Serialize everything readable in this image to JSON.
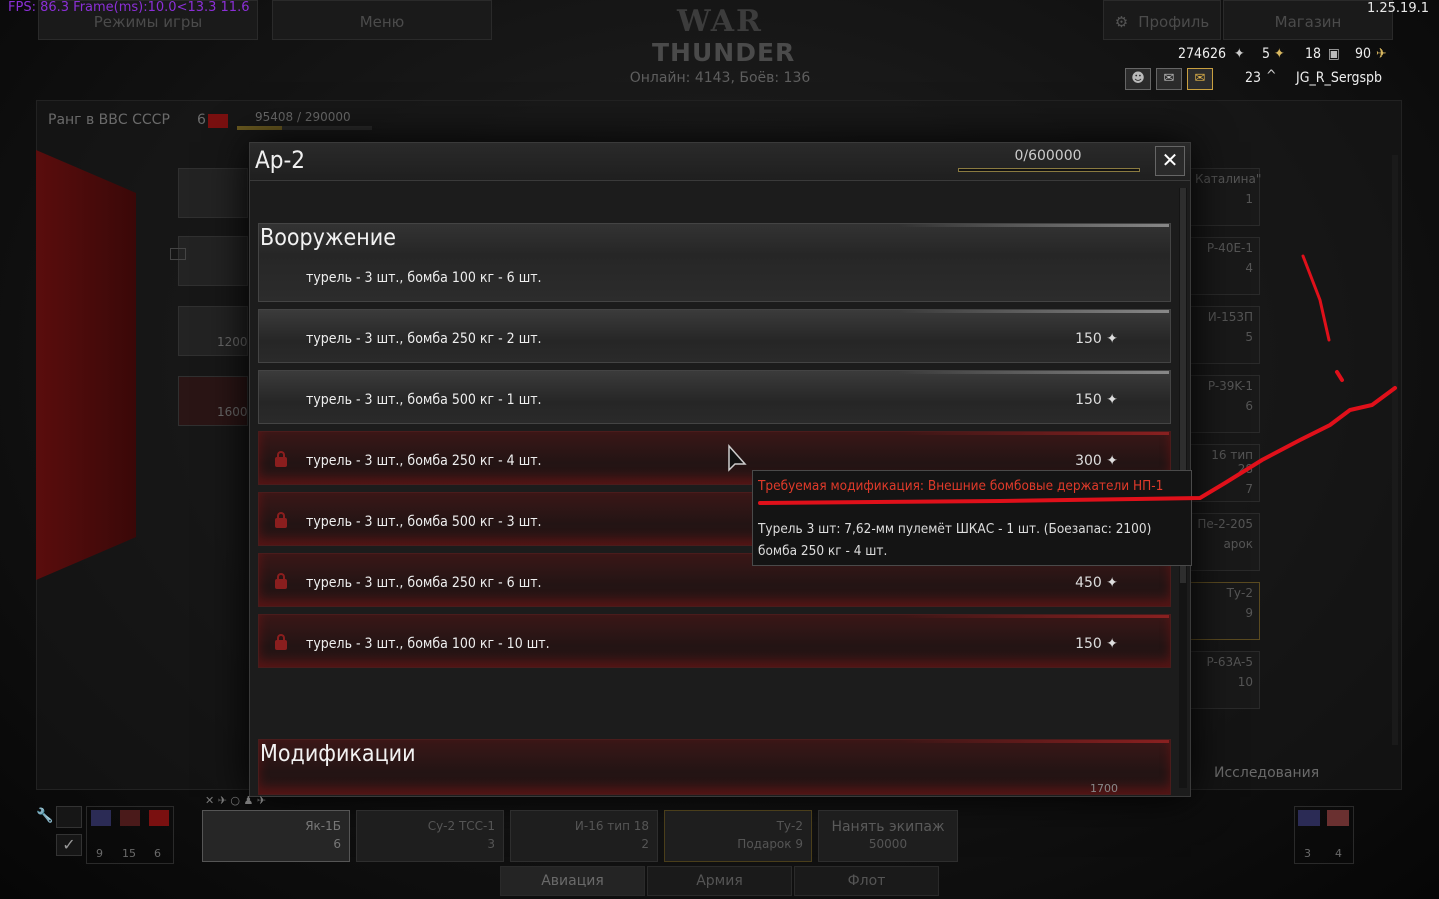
{
  "hud": {
    "fps": "FPS: 86.3 Frame(ms):10.0<13.3 11.6",
    "version": "1.25.19.1"
  },
  "topbar": {
    "game_modes": "Режимы игры",
    "menu": "Меню",
    "profile": "Профиль",
    "shop": "Магазин"
  },
  "logo": {
    "line1": "WAR",
    "line2": "THUNDER"
  },
  "online": "Онлайн: 4143, Боёв: 136",
  "player": {
    "silver_lions": "274626",
    "gold": "5",
    "stat3": "18",
    "stat4": "90",
    "level": "23",
    "name": "JG_R_Sergspb"
  },
  "hangar": {
    "rank_label": "Ранг в ВВС СССР",
    "rank_num": "6",
    "rank_progress": "95408 / 290000",
    "left_costs": [
      "1200",
      "1600"
    ],
    "right_cards": [
      {
        "name": "Каталина\"",
        "rank": "1"
      },
      {
        "name": "P-40E-1",
        "rank": "4"
      },
      {
        "name": "И-153П",
        "rank": "5"
      },
      {
        "name": "P-39K-1",
        "rank": "6"
      },
      {
        "name": "16 тип 28",
        "rank": "7"
      },
      {
        "name": "Пе-2-205",
        "rank": "арок"
      },
      {
        "name": "Ту-2",
        "rank": "9"
      },
      {
        "name": "P-63A-5",
        "rank": "10"
      }
    ],
    "research": "Исследования"
  },
  "modal": {
    "title": "Ар-2",
    "rp": "0/600000",
    "close": "✕",
    "section_armament": "Вооружение",
    "section_mods": "Модификации",
    "mods_peek_cost": "1700",
    "rows": [
      {
        "label": "турель - 3 шт., бомба 100 кг - 6 шт.",
        "cost": "",
        "locked": false
      },
      {
        "label": "турель - 3 шт., бомба 250 кг - 2 шт.",
        "cost": "150",
        "locked": false
      },
      {
        "label": "турель - 3 шт., бомба 500 кг - 1 шт.",
        "cost": "150",
        "locked": false
      },
      {
        "label": "турель - 3 шт., бомба 250 кг - 4 шт.",
        "cost": "300",
        "locked": true
      },
      {
        "label": "турель - 3 шт., бомба 500 кг - 3 шт.",
        "cost": "",
        "locked": true
      },
      {
        "label": "турель - 3 шт., бомба 250 кг - 6 шт.",
        "cost": "450",
        "locked": true
      },
      {
        "label": "турель - 3 шт., бомба 100 кг - 10 шт.",
        "cost": "150",
        "locked": true
      }
    ]
  },
  "tooltip": {
    "required": "Требуемая модификация: Внешние бомбовые держатели НП-1",
    "line1": "Турель 3 шт: 7,62-мм пулемёт ШКАС - 1 шт. (Боезапас: 2100)",
    "line2": "бомба 250 кг - 4 шт."
  },
  "crew": {
    "nation_counts": [
      "9",
      "15",
      "6"
    ],
    "right_counts": [
      "3",
      "4"
    ],
    "slots": [
      {
        "name": "Як-1Б",
        "rank": "6"
      },
      {
        "name": "Су-2 ТСС-1",
        "rank": "3"
      },
      {
        "name": "И-16 тип 18",
        "rank": "2"
      },
      {
        "name": "Ту-2",
        "rank": "9",
        "extra": "Подарок"
      }
    ],
    "hire_label": "Нанять экипаж",
    "hire_cost": "50000"
  },
  "bottom_tabs": {
    "aviation": "Авиация",
    "army": "Армия",
    "fleet": "Флот"
  },
  "colors": {
    "accent_red": "#e03a2a",
    "annotation_red": "#e0101a"
  }
}
